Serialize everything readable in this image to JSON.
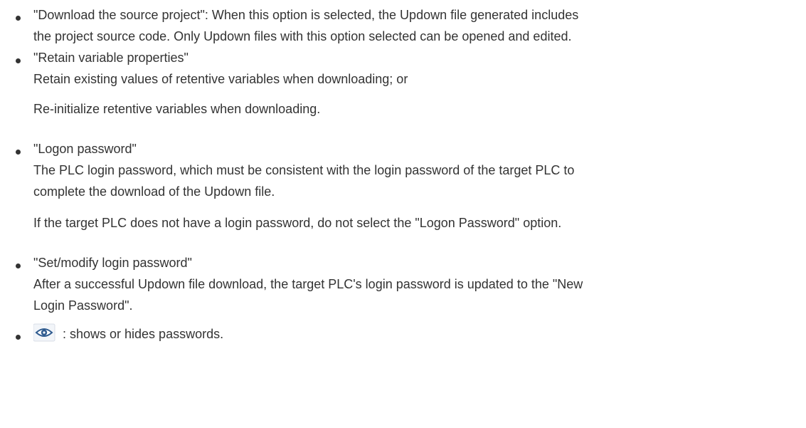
{
  "items": [
    {
      "lines": [
        "\"Download the source project\": When this option is selected, the Updown file generated includes",
        "the project source code. Only Updown files with this option selected can be opened and edited."
      ]
    },
    {
      "lines": [
        "\"Retain variable properties\"",
        "Retain existing values of retentive variables when downloading; or"
      ],
      "para": "Re-initialize retentive variables when downloading."
    },
    {
      "lines": [
        "\"Logon password\"",
        "The PLC login password, which must be consistent with the login password of the target PLC to",
        "complete the download of the Updown file."
      ],
      "para": "If the target PLC does not have a login password, do not select the \"Logon Password\" option."
    },
    {
      "lines": [
        "\"Set/modify login password\"",
        "After a successful Updown file download, the target PLC's login password is updated to the \"New",
        "Login Password\"."
      ]
    },
    {
      "icon": "eye-icon",
      "text": ": shows or hides passwords."
    }
  ]
}
